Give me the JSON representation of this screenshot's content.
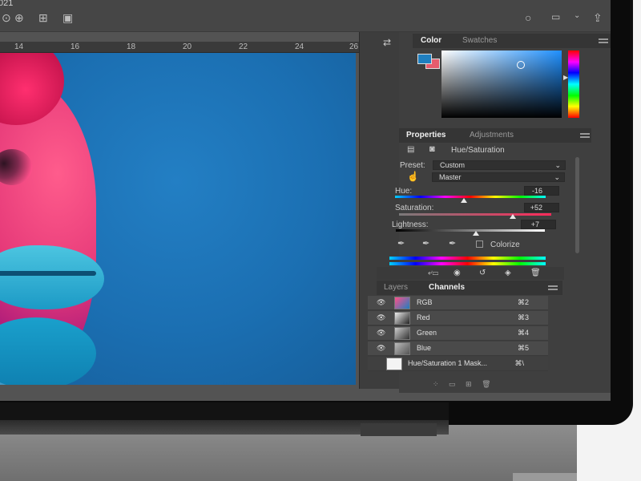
{
  "topbar": {
    "title_fragment": "021",
    "icons": [
      "align-icon",
      "distribute-icon",
      "arrange-icon",
      "video-icon",
      "search-icon",
      "workspace-icon",
      "share-icon"
    ]
  },
  "ruler": {
    "ticks": [
      "14",
      "16",
      "18",
      "20",
      "22",
      "24",
      "26"
    ]
  },
  "color_panel": {
    "tabs": [
      "Color",
      "Swatches"
    ],
    "foreground": "#1f7fc0",
    "background": "#e75c6d"
  },
  "properties_panel": {
    "tabs": [
      "Properties",
      "Adjustments"
    ],
    "adjustment_name": "Hue/Saturation",
    "preset_label": "Preset:",
    "preset_value": "Custom",
    "channel_value": "Master",
    "hue_label": "Hue:",
    "hue_value": "-16",
    "saturation_label": "Saturation:",
    "saturation_value": "+52",
    "lightness_label": "Lightness:",
    "lightness_value": "+7",
    "colorize_label": "Colorize"
  },
  "layers_panel": {
    "tabs": [
      "Layers",
      "Channels"
    ],
    "channels": [
      {
        "name": "RGB",
        "shortcut": "⌘2"
      },
      {
        "name": "Red",
        "shortcut": "⌘3"
      },
      {
        "name": "Green",
        "shortcut": "⌘4"
      },
      {
        "name": "Blue",
        "shortcut": "⌘5"
      },
      {
        "name": "Hue/Saturation 1 Mask...",
        "shortcut": "⌘\\"
      }
    ]
  }
}
